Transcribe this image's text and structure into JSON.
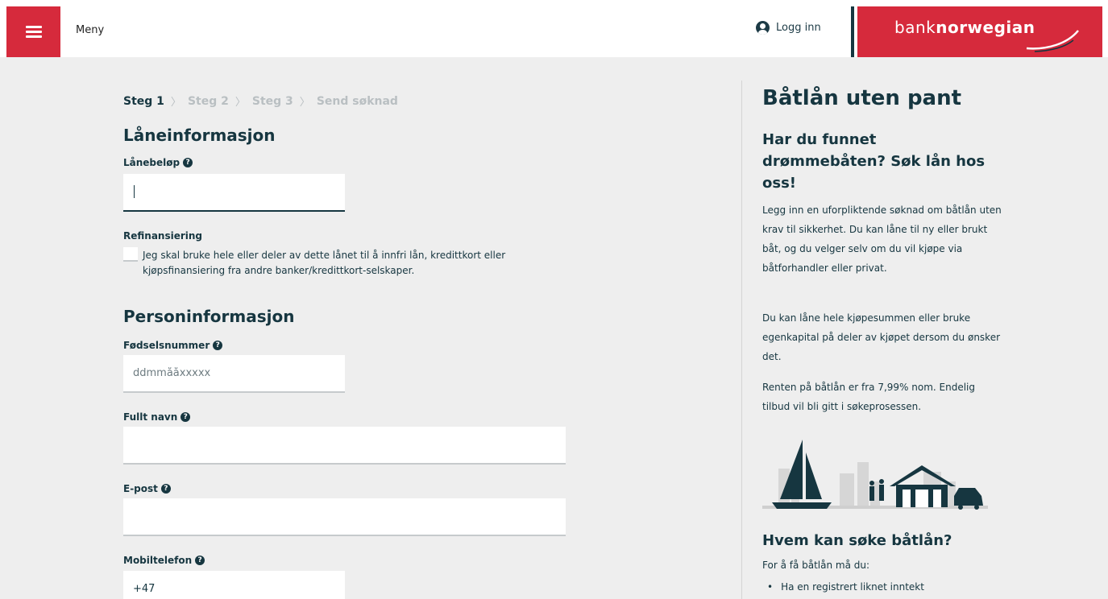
{
  "header": {
    "menu_label": "Meny",
    "login_label": "Logg inn",
    "brand": {
      "part1": "bank",
      "part2": "norwegian",
      "color": "#d62a3c"
    }
  },
  "steps": [
    {
      "label": "Steg 1",
      "active": true
    },
    {
      "label": "Steg 2",
      "active": false
    },
    {
      "label": "Steg 3",
      "active": false
    },
    {
      "label": "Send søknad",
      "active": false
    }
  ],
  "form": {
    "loan_section_title": "Låneinformasjon",
    "loan_amount_label": "Lånebeløp",
    "loan_amount_value": "",
    "refinance_label": "Refinansiering",
    "refinance_text": "Jeg skal bruke hele eller deler av dette lånet til å innfri lån, kredittkort eller kjøpsfinansiering fra andre banker/kredittkort-selskaper.",
    "person_section_title": "Personinformasjon",
    "ssn_label": "Fødselsnummer",
    "ssn_placeholder": "ddmmååxxxxx",
    "name_label": "Fullt navn",
    "email_label": "E-post",
    "phone_label": "Mobiltelefon",
    "phone_value": "+47"
  },
  "sidebar": {
    "title": "Båtlån uten pant",
    "subtitle": "Har du funnet drømmebåten? Søk lån hos oss!",
    "paragraphs": [
      "Legg inn en uforpliktende søknad om båtlån uten krav til sikkerhet. Du kan låne til ny eller brukt båt, og du velger selv om du vil kjøpe via båtforhandler eller privat.",
      "Du kan låne hele kjøpesummen eller bruke egenkapital på deler av kjøpet dersom du ønsker det.",
      "Renten på båtlån er fra 7,99% nom. Endelig tilbud vil bli gitt i søkeprosessen."
    ],
    "who_title": "Hvem kan søke båtlån?",
    "who_intro": "For å få båtlån må du:",
    "requirements": [
      "Ha en registrert liknet inntekt"
    ]
  },
  "colors": {
    "accent": "#d62a3c",
    "navy": "#163640",
    "background": "#eeeeee"
  },
  "icons": [
    "menu-icon",
    "user-icon",
    "help-icon"
  ]
}
